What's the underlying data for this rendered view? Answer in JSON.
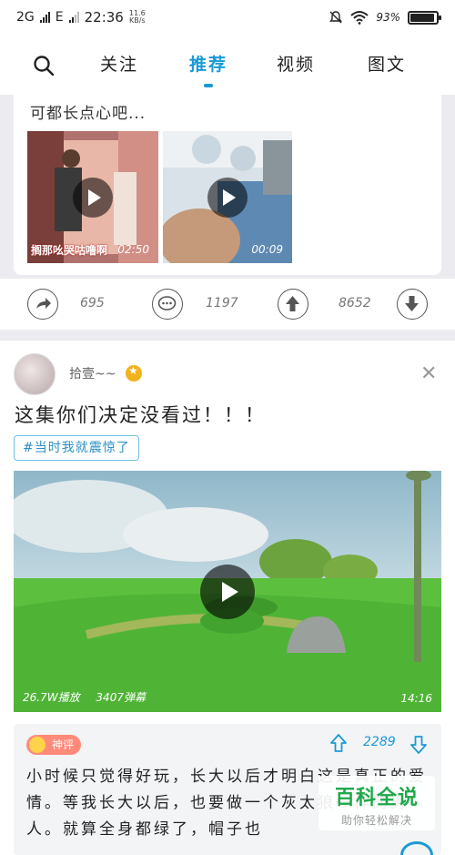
{
  "status_bar": {
    "network_label": "2G",
    "network_type": "E",
    "time": "22:36",
    "speed_value": "11.6",
    "speed_unit": "KB/s",
    "battery": "93%",
    "battery_level": 0.93
  },
  "nav": {
    "tabs": [
      {
        "label": "关注",
        "active": false
      },
      {
        "label": "推荐",
        "active": true
      },
      {
        "label": "视频",
        "active": false
      },
      {
        "label": "图文",
        "active": false
      }
    ],
    "search_icon": "search-icon",
    "accent_color": "#1a9ad6"
  },
  "card1": {
    "text": "可都长点心吧...",
    "thumbs": [
      {
        "caption": "搁那吆哭咕噜啊",
        "duration": "02:50"
      },
      {
        "caption": "",
        "duration": "00:09"
      }
    ],
    "actions": {
      "share_count": "695",
      "comment_count": "1197",
      "up_count": "8652"
    }
  },
  "post2": {
    "username": "拾壹~~",
    "title": "这集你们决定没看过！！！",
    "tag": "#当时我就震惊了",
    "video": {
      "plays": "26.7W播放",
      "danmaku": "3407弹幕",
      "duration": "14:16"
    },
    "hot_comment": {
      "badge": "神评",
      "votes": "2289",
      "text": "小时候只觉得好玩，长大以后才明白这是真正的爱情。等我长大以后，也要做一个灰太狼一样的男人。就算全身都绿了，帽子也"
    }
  },
  "watermark": {
    "title": "百科全说",
    "subtitle": "助你轻松解决"
  }
}
